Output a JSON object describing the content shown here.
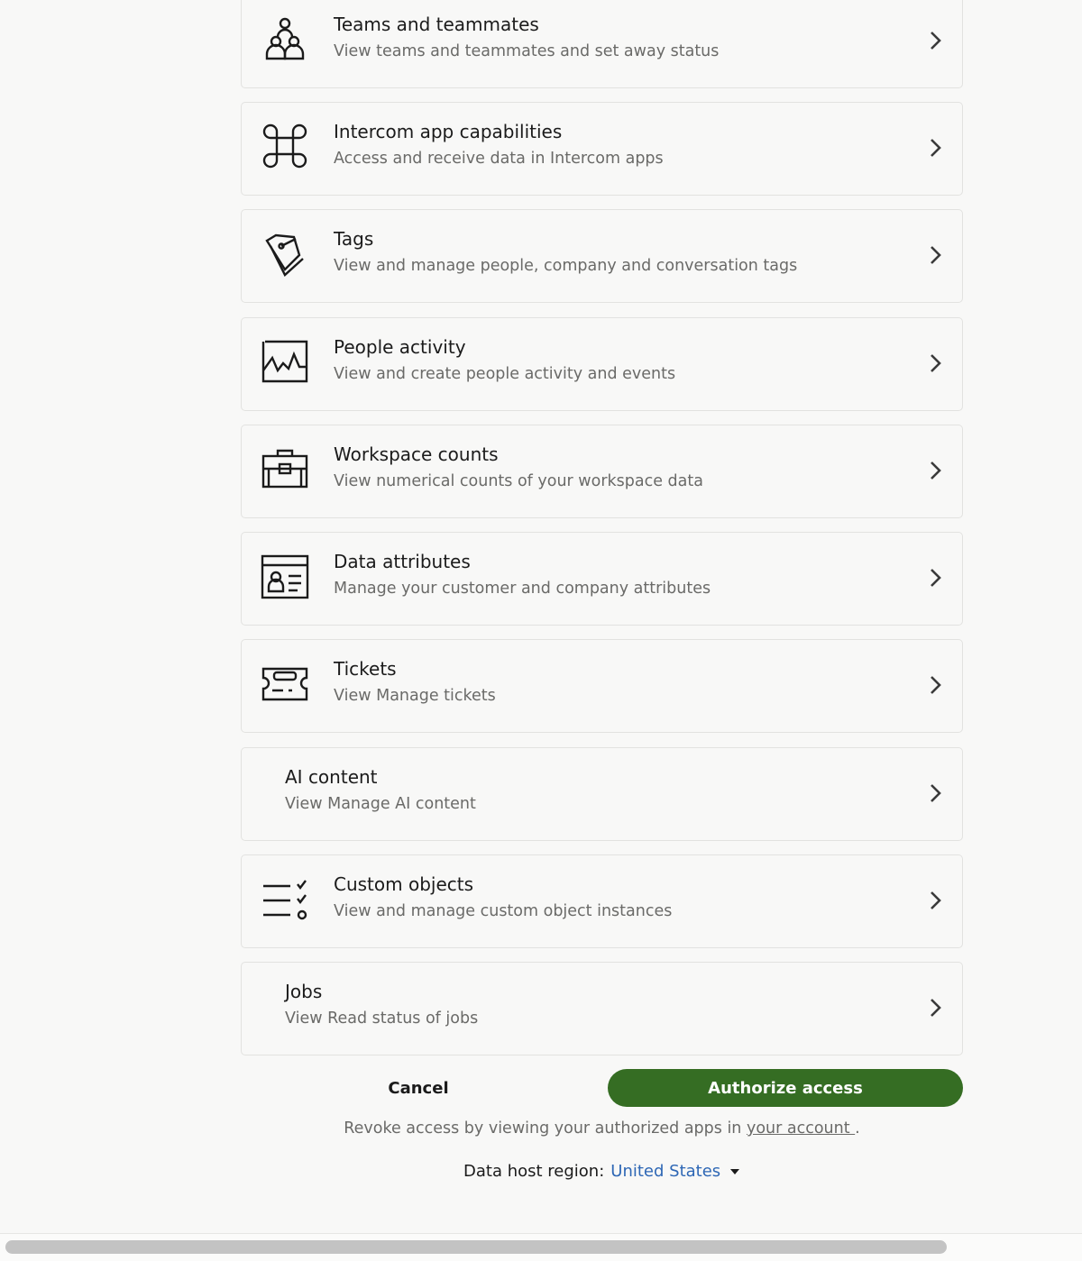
{
  "permissions": [
    {
      "title": "Teams and teammates",
      "description": "View teams and teammates and set away status",
      "icon": "people-group-icon"
    },
    {
      "title": "Intercom app capabilities",
      "description": "Access and receive data in Intercom apps",
      "icon": "command-key-icon"
    },
    {
      "title": "Tags",
      "description": "View and manage people, company and conversation tags",
      "icon": "tag-icon"
    },
    {
      "title": "People activity",
      "description": "View and create people activity and events",
      "icon": "activity-chart-icon"
    },
    {
      "title": "Workspace counts",
      "description": "View numerical counts of your workspace data",
      "icon": "briefcase-icon"
    },
    {
      "title": "Data attributes",
      "description": "Manage your customer and company attributes",
      "icon": "contact-card-icon"
    },
    {
      "title": "Tickets",
      "description": "View Manage tickets",
      "icon": "ticket-icon"
    },
    {
      "title": "AI content",
      "description": "View Manage AI content",
      "icon": ""
    },
    {
      "title": "Custom objects",
      "description": "View and manage custom object instances",
      "icon": "checklist-icon"
    },
    {
      "title": "Jobs",
      "description": "View Read status of jobs",
      "icon": ""
    }
  ],
  "actions": {
    "cancel_label": "Cancel",
    "authorize_label": "Authorize access",
    "authorize_color": "#356d23"
  },
  "footer": {
    "revoke_text": "Revoke access by viewing your authorized apps in ",
    "revoke_link": "your account ",
    "revoke_end": ".",
    "region_label": "Data host region:",
    "region_value": "United States"
  }
}
